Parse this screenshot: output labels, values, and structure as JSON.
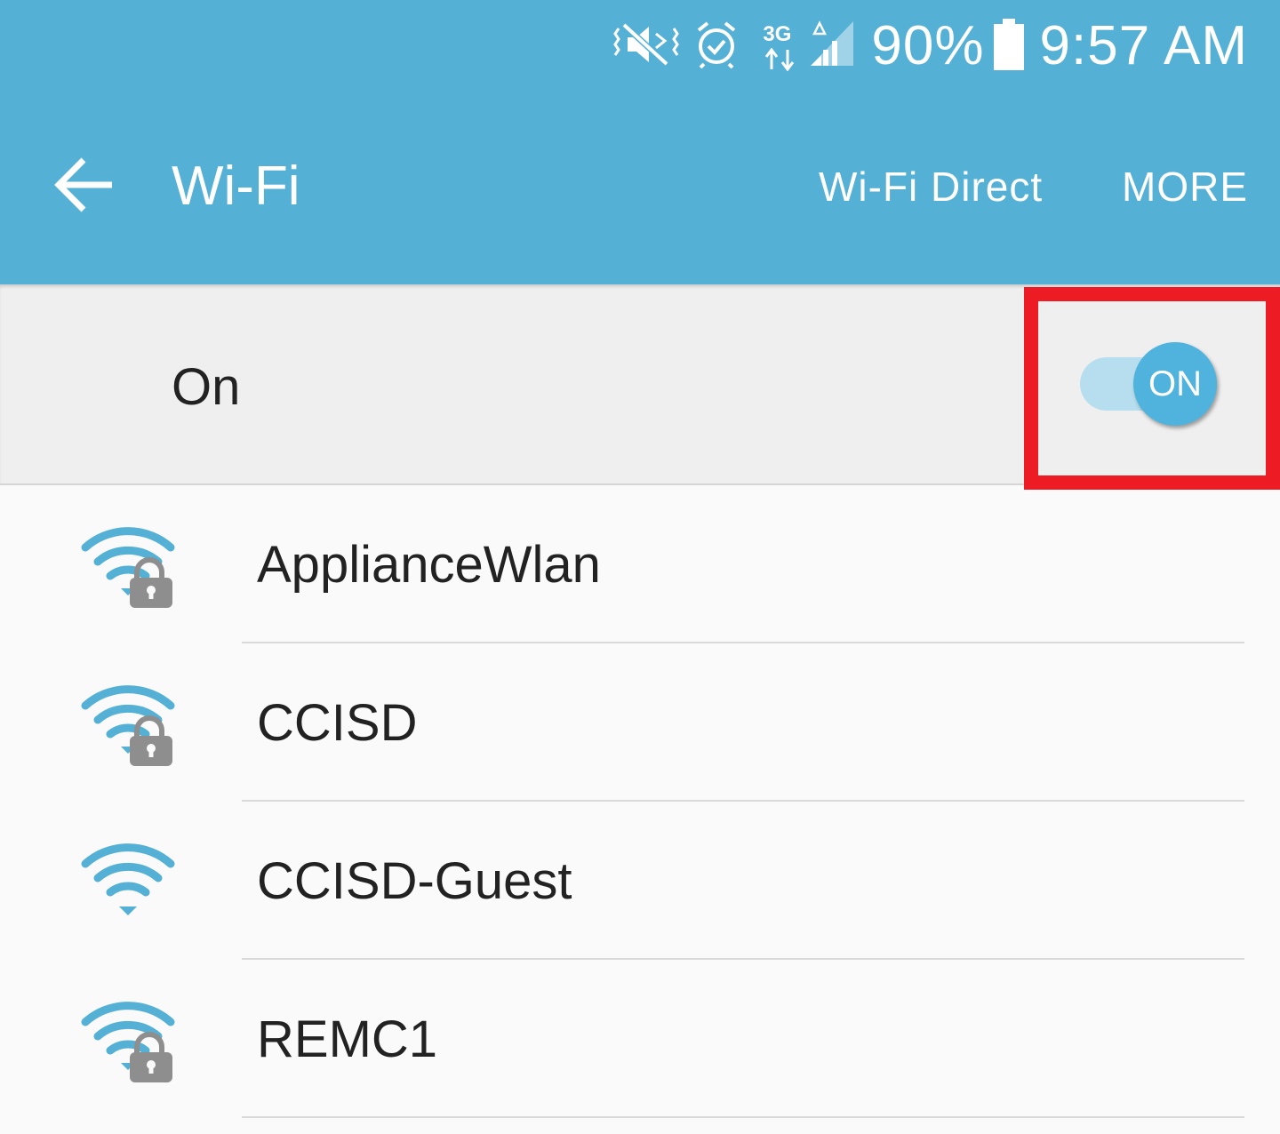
{
  "status_bar": {
    "icons": [
      "vibrate-mute-icon",
      "alarm-icon",
      "3g-data-icon",
      "cell-signal-icon",
      "battery-icon"
    ],
    "network_type": "3G",
    "battery": "90%",
    "time": "9:57 AM"
  },
  "app_bar": {
    "back_icon": "arrow-back-icon",
    "title": "Wi-Fi",
    "actions": {
      "wifi_direct": "Wi-Fi Direct",
      "more": "MORE"
    }
  },
  "master_switch": {
    "label": "On",
    "toggle_text": "ON",
    "enabled": true
  },
  "colors": {
    "accent": "#55b0d6",
    "toggle_thumb": "#4fb3dd",
    "toggle_track": "#b7deee",
    "highlight": "#ed1c24",
    "lock_gray": "#8e8e8e"
  },
  "networks": [
    {
      "ssid": "ApplianceWlan",
      "icon": "wifi-lock-icon",
      "secured": true
    },
    {
      "ssid": "CCISD",
      "icon": "wifi-lock-icon",
      "secured": true
    },
    {
      "ssid": "CCISD-Guest",
      "icon": "wifi-icon",
      "secured": false
    },
    {
      "ssid": "REMC1",
      "icon": "wifi-lock-icon",
      "secured": true
    }
  ]
}
